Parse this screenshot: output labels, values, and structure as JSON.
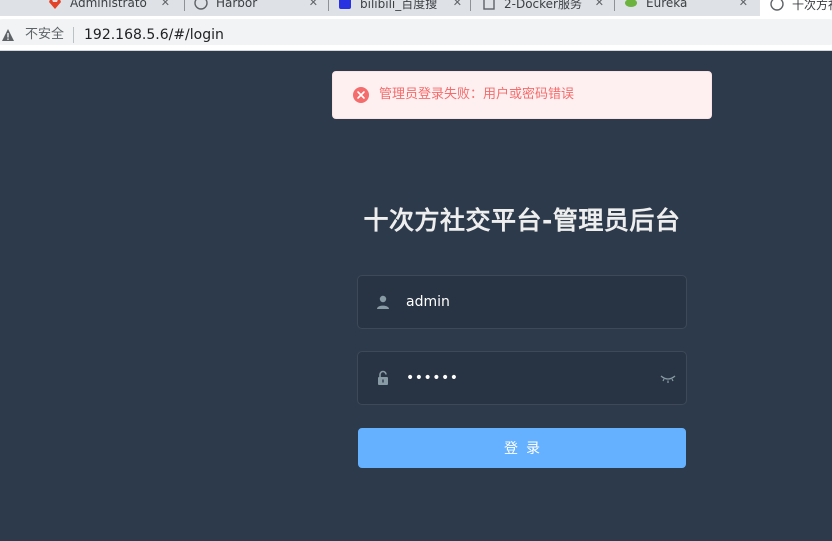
{
  "browser": {
    "tabs": [
      {
        "title": "Administrato",
        "close": "✕"
      },
      {
        "title": "Harbor",
        "close": "✕"
      },
      {
        "title": "bilibili_百度搜",
        "close": "✕"
      },
      {
        "title": "2-Docker服务",
        "close": "✕"
      },
      {
        "title": "Eureka",
        "close": "✕"
      },
      {
        "title": "十次方社",
        "close": ""
      }
    ],
    "security_label": "不安全",
    "url": "192.168.5.6/#/login"
  },
  "alert": {
    "message": "管理员登录失败：用户或密码错误",
    "color": "#f56c6c"
  },
  "login": {
    "title": "十次方社交平台-管理员后台",
    "username_value": "admin",
    "password_value": "••••••",
    "submit_label": "登录",
    "button_color": "#66b1ff"
  }
}
